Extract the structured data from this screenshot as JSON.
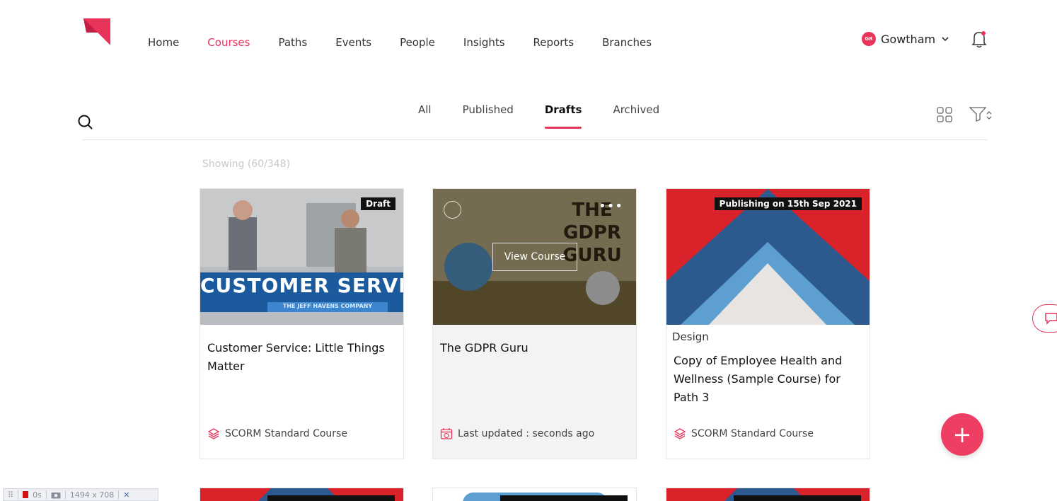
{
  "nav": {
    "items": [
      {
        "label": "Home",
        "active": false
      },
      {
        "label": "Courses",
        "active": true
      },
      {
        "label": "Paths",
        "active": false
      },
      {
        "label": "Events",
        "active": false
      },
      {
        "label": "People",
        "active": false
      },
      {
        "label": "Insights",
        "active": false
      },
      {
        "label": "Reports",
        "active": false
      },
      {
        "label": "Branches",
        "active": false
      }
    ],
    "user": {
      "initials": "GR",
      "name": "Gowtham"
    }
  },
  "tabs": [
    {
      "label": "All",
      "active": false
    },
    {
      "label": "Published",
      "active": false
    },
    {
      "label": "Drafts",
      "active": true
    },
    {
      "label": "Archived",
      "active": false
    }
  ],
  "showing": "Showing (60/348)",
  "cards": [
    {
      "badge": "Draft",
      "title": "Customer Service: Little Things Matter",
      "footer": "SCORM Standard Course",
      "thumb_text": "CUSTOMER SERVICE",
      "thumb_subtext": "THE JEFF HAVENS COMPANY"
    },
    {
      "title": "The GDPR Guru",
      "footer": "Last updated : seconds ago",
      "view_label": "View Course",
      "thumb_text": "THE GDPR GURU"
    },
    {
      "badge": "Publishing on 15th Sep 2021",
      "category": "Design",
      "title": "Copy of Employee Health and Wellness (Sample Course) for Path 3",
      "footer": "SCORM Standard Course"
    }
  ],
  "devbar": {
    "time": "0s",
    "size": "1494 x 708"
  },
  "colors": {
    "accent": "#e8345a",
    "fab": "#ef3e63"
  }
}
